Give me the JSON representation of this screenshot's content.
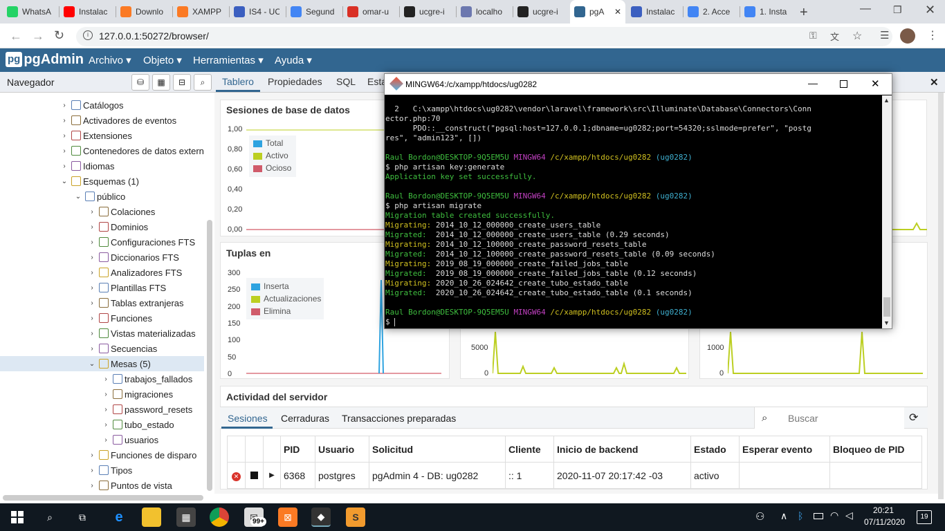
{
  "browser": {
    "tabs": [
      {
        "label": "WhatsA",
        "color": "#25d366",
        "icon": "whatsapp-icon"
      },
      {
        "label": "Instalac",
        "color": "#ff0000",
        "icon": "youtube-icon"
      },
      {
        "label": "Downlo",
        "color": "#fb7a24",
        "icon": "xampp-icon"
      },
      {
        "label": "XAMPP",
        "color": "#fb7a24",
        "icon": "xampp-icon"
      },
      {
        "label": "IS4 - UC",
        "color": "#3b5fc0",
        "icon": "classroom-icon"
      },
      {
        "label": "Segund",
        "color": "#4285f4",
        "icon": "docs-icon"
      },
      {
        "label": "omar-u",
        "color": "#d93025",
        "icon": "gmail-icon"
      },
      {
        "label": "ucgre-i",
        "color": "#222222",
        "icon": "github-icon"
      },
      {
        "label": "localho",
        "color": "#6c78af",
        "icon": "phpmyadmin-icon"
      },
      {
        "label": "ucgre-i",
        "color": "#222222",
        "icon": "github-icon"
      },
      {
        "label": "pgA",
        "color": "#326690",
        "icon": "pgadmin-icon"
      },
      {
        "label": "Instalac",
        "color": "#3b5fc0",
        "icon": "classroom-icon"
      },
      {
        "label": "2. Acce",
        "color": "#4285f4",
        "icon": "docs-icon"
      },
      {
        "label": "1. Insta",
        "color": "#4285f4",
        "icon": "docs-icon"
      }
    ],
    "url": "127.0.0.1:50272/browser/"
  },
  "app": {
    "logo": "pgAdmin",
    "menus": [
      "Archivo ▾",
      "Objeto ▾",
      "Herramientas ▾",
      "Ayuda ▾"
    ]
  },
  "navigator": {
    "title": "Navegador",
    "tree": [
      {
        "label": "Catálogos",
        "level": 1,
        "arrow": "›",
        "icon": "catalog-icon"
      },
      {
        "label": "Activadores de eventos",
        "level": 1,
        "arrow": "›",
        "icon": "event-trigger-icon"
      },
      {
        "label": "Extensiones",
        "level": 1,
        "arrow": "›",
        "icon": "extension-icon"
      },
      {
        "label": "Contenedores de datos extern",
        "level": 1,
        "arrow": "›",
        "icon": "foreign-data-icon"
      },
      {
        "label": "Idiomas",
        "level": 1,
        "arrow": "›",
        "icon": "language-icon"
      },
      {
        "label": "Esquemas (1)",
        "level": 1,
        "arrow": "⌄",
        "icon": "schemas-icon"
      },
      {
        "label": "público",
        "level": 2,
        "arrow": "⌄",
        "icon": "schema-icon"
      },
      {
        "label": "Colaciones",
        "level": 3,
        "arrow": "›",
        "icon": "collation-icon"
      },
      {
        "label": "Dominios",
        "level": 3,
        "arrow": "›",
        "icon": "domain-icon"
      },
      {
        "label": "Configuraciones FTS",
        "level": 3,
        "arrow": "›",
        "icon": "fts-config-icon"
      },
      {
        "label": "Diccionarios FTS",
        "level": 3,
        "arrow": "›",
        "icon": "fts-dictionary-icon"
      },
      {
        "label": "Analizadores FTS",
        "level": 3,
        "arrow": "›",
        "icon": "fts-parser-icon"
      },
      {
        "label": "Plantillas FTS",
        "level": 3,
        "arrow": "›",
        "icon": "fts-template-icon"
      },
      {
        "label": "Tablas extranjeras",
        "level": 3,
        "arrow": "›",
        "icon": "foreign-table-icon"
      },
      {
        "label": "Funciones",
        "level": 3,
        "arrow": "›",
        "icon": "function-icon"
      },
      {
        "label": "Vistas materializadas",
        "level": 3,
        "arrow": "›",
        "icon": "materialized-view-icon"
      },
      {
        "label": "Secuencias",
        "level": 3,
        "arrow": "›",
        "icon": "sequence-icon"
      },
      {
        "label": "Mesas (5)",
        "level": 3,
        "arrow": "⌄",
        "icon": "tables-icon",
        "selected": true
      },
      {
        "label": "trabajos_fallados",
        "level": 4,
        "arrow": "›",
        "icon": "table-icon"
      },
      {
        "label": "migraciones",
        "level": 4,
        "arrow": "›",
        "icon": "table-icon"
      },
      {
        "label": "password_resets",
        "level": 4,
        "arrow": "›",
        "icon": "table-icon"
      },
      {
        "label": "tubo_estado",
        "level": 4,
        "arrow": "›",
        "icon": "table-icon"
      },
      {
        "label": "usuarios",
        "level": 4,
        "arrow": "›",
        "icon": "table-icon"
      },
      {
        "label": "Funciones de disparo",
        "level": 3,
        "arrow": "›",
        "icon": "trigger-function-icon"
      },
      {
        "label": "Tipos",
        "level": 3,
        "arrow": "›",
        "icon": "type-icon"
      },
      {
        "label": "Puntos de vista",
        "level": 3,
        "arrow": "›",
        "icon": "view-icon"
      }
    ]
  },
  "main": {
    "tabs": [
      "Tablero",
      "Propiedades",
      "SQL",
      "Esta"
    ],
    "sessions_chart": {
      "title": "Sesiones de base de datos",
      "yticks": [
        "1,00",
        "0,80",
        "0,60",
        "0,40",
        "0,20",
        "0,00"
      ],
      "legend": [
        {
          "name": "Total",
          "color": "#2ea3e0"
        },
        {
          "name": "Activo",
          "color": "#bccf22"
        },
        {
          "name": "Ocioso",
          "color": "#d05b6a"
        }
      ]
    },
    "tuples_chart": {
      "title": "Tuplas en",
      "yticks": [
        "300",
        "250",
        "200",
        "150",
        "100",
        "50",
        "0"
      ],
      "legend": [
        {
          "name": "Inserta",
          "color": "#2ea3e0"
        },
        {
          "name": "Actualizaciones",
          "color": "#bccf22"
        },
        {
          "name": "Elimina",
          "color": "#d05b6a"
        }
      ]
    },
    "tuples_out_ticks": [
      "5000",
      "0"
    ],
    "block_io_ticks": [
      "1000",
      "0"
    ],
    "activity": {
      "title": "Actividad del servidor",
      "tabs": [
        "Sesiones",
        "Cerraduras",
        "Transacciones preparadas"
      ],
      "search_placeholder": "Buscar",
      "columns": [
        "",
        "",
        "",
        "PID",
        "Usuario",
        "Solicitud",
        "Cliente",
        "Inicio de backend",
        "Estado",
        "Esperar evento",
        "Bloqueo de PID"
      ],
      "rows": [
        {
          "pid": "6368",
          "user": "postgres",
          "query": "pgAdmin 4 - DB: ug0282",
          "client": ":: 1",
          "start": "2020-11-07 20:17:42 -03",
          "state": "activo",
          "wait": "",
          "blocking": ""
        }
      ]
    }
  },
  "terminal": {
    "title": "MINGW64:/c/xampp/htdocs/ug0282",
    "lines": [
      [
        {
          "t": "  2   C:\\xampp\\htdocs\\ug0282\\vendor\\laravel\\framework\\src\\Illuminate\\Database\\Connectors\\Conn",
          "c": "w"
        }
      ],
      [
        {
          "t": "ector.php:70",
          "c": "w"
        }
      ],
      [
        {
          "t": "      PDO::__construct(\"pgsql:host=127.0.0.1;dbname=ug0282;port=54320;sslmode=prefer\", \"postg",
          "c": "w"
        }
      ],
      [
        {
          "t": "res\", \"admin123\", [])",
          "c": "w"
        }
      ],
      [],
      [
        {
          "t": "Raul Bordon@DESKTOP-9Q5EM5U ",
          "c": "g"
        },
        {
          "t": "MINGW64 ",
          "c": "m"
        },
        {
          "t": "/c/xampp/htdocs/ug0282 ",
          "c": "y"
        },
        {
          "t": "(ug0282)",
          "c": "c"
        }
      ],
      [
        {
          "t": "$ php artisan key:generate",
          "c": "w"
        }
      ],
      [
        {
          "t": "Application key set successfully.",
          "c": "g"
        }
      ],
      [],
      [
        {
          "t": "Raul Bordon@DESKTOP-9Q5EM5U ",
          "c": "g"
        },
        {
          "t": "MINGW64 ",
          "c": "m"
        },
        {
          "t": "/c/xampp/htdocs/ug0282 ",
          "c": "y"
        },
        {
          "t": "(ug0282)",
          "c": "c"
        }
      ],
      [
        {
          "t": "$ php artisan migrate",
          "c": "w"
        }
      ],
      [
        {
          "t": "Migration table created successfully.",
          "c": "g"
        }
      ],
      [
        {
          "t": "Migrating: ",
          "c": "y"
        },
        {
          "t": "2014_10_12_000000_create_users_table",
          "c": "w"
        }
      ],
      [
        {
          "t": "Migrated:  ",
          "c": "g"
        },
        {
          "t": "2014_10_12_000000_create_users_table (0.29 seconds)",
          "c": "w"
        }
      ],
      [
        {
          "t": "Migrating: ",
          "c": "y"
        },
        {
          "t": "2014_10_12_100000_create_password_resets_table",
          "c": "w"
        }
      ],
      [
        {
          "t": "Migrated:  ",
          "c": "g"
        },
        {
          "t": "2014_10_12_100000_create_password_resets_table (0.09 seconds)",
          "c": "w"
        }
      ],
      [
        {
          "t": "Migrating: ",
          "c": "y"
        },
        {
          "t": "2019_08_19_000000_create_failed_jobs_table",
          "c": "w"
        }
      ],
      [
        {
          "t": "Migrated:  ",
          "c": "g"
        },
        {
          "t": "2019_08_19_000000_create_failed_jobs_table (0.12 seconds)",
          "c": "w"
        }
      ],
      [
        {
          "t": "Migrating: ",
          "c": "y"
        },
        {
          "t": "2020_10_26_024642_create_tubo_estado_table",
          "c": "w"
        }
      ],
      [
        {
          "t": "Migrated:  ",
          "c": "g"
        },
        {
          "t": "2020_10_26_024642_create_tubo_estado_table (0.1 seconds)",
          "c": "w"
        }
      ],
      [],
      [
        {
          "t": "Raul Bordon@DESKTOP-9Q5EM5U ",
          "c": "g"
        },
        {
          "t": "MINGW64 ",
          "c": "m"
        },
        {
          "t": "/c/xampp/htdocs/ug0282 ",
          "c": "y"
        },
        {
          "t": "(ug0282)",
          "c": "c"
        }
      ],
      [
        {
          "t": "$ ",
          "c": "w"
        }
      ]
    ]
  },
  "taskbar": {
    "mail_badge": "99+",
    "time": "20:21",
    "date": "07/11/2020",
    "notification_count": "19"
  }
}
